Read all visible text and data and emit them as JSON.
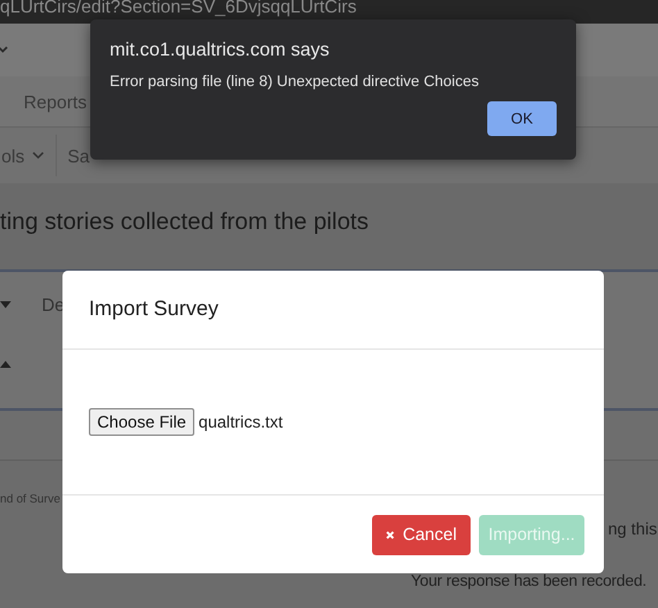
{
  "address_bar": {
    "url": "qLUrtCirs/edit?Section=SV_6DvjsqqLUrtCirs"
  },
  "page": {
    "nav_tabs": [
      {
        "label": "Reports"
      }
    ],
    "toolbar": [
      {
        "label": "ols",
        "kind": "dropdown"
      },
      {
        "label": "Sa",
        "kind": "plain"
      }
    ],
    "survey_title": "ting stories collected from the pilots",
    "block_label": "De",
    "end_label": "nd of Surve",
    "end_message": [
      "ng this",
      "Your response has been recorded."
    ]
  },
  "alert": {
    "origin": "mit.co1.qualtrics.com says",
    "message": "Error parsing file (line 8) Unexpected directive Choices",
    "button": "OK"
  },
  "modal": {
    "title": "Import Survey",
    "file_button": "Choose File",
    "file_name": "qualtrics.txt",
    "buttons": [
      {
        "label": "Cancel",
        "kind": "cancel",
        "disabled": false
      },
      {
        "label": "Importing...",
        "kind": "primary",
        "disabled": true
      }
    ]
  }
}
